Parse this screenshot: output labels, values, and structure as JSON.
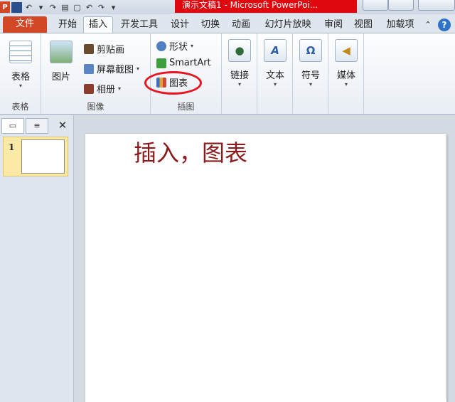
{
  "window": {
    "title": "演示文稿1 - Microsoft PowerPoi..."
  },
  "qat": {
    "app_icon": "P"
  },
  "tabs": [
    {
      "label": "文件"
    },
    {
      "label": "开始"
    },
    {
      "label": "插入"
    },
    {
      "label": "开发工具"
    },
    {
      "label": "设计"
    },
    {
      "label": "切换"
    },
    {
      "label": "动画"
    },
    {
      "label": "幻灯片放映"
    },
    {
      "label": "审阅"
    },
    {
      "label": "视图"
    },
    {
      "label": "加载项"
    }
  ],
  "ribbon": {
    "table": {
      "button": "表格",
      "group": "表格"
    },
    "images": {
      "picture": "图片",
      "clipart": "剪贴画",
      "screenshot": "屏幕截图",
      "album": "相册",
      "group": "图像"
    },
    "illustrations": {
      "shapes": "形状",
      "smartart": "SmartArt",
      "chart": "图表",
      "group": "插图"
    },
    "links": {
      "button": "链接"
    },
    "text": {
      "button": "文本"
    },
    "symbols": {
      "button": "符号",
      "icon": "Ω"
    },
    "media": {
      "button": "媒体"
    }
  },
  "panel": {
    "slide_number": "1"
  },
  "slide": {
    "title": "插入，图表"
  },
  "colors": {
    "file_tab": "#d24726",
    "title_highlight": "#e0080f",
    "annotation_circle": "#e8141e",
    "slide_text": "#8b1a1a"
  }
}
